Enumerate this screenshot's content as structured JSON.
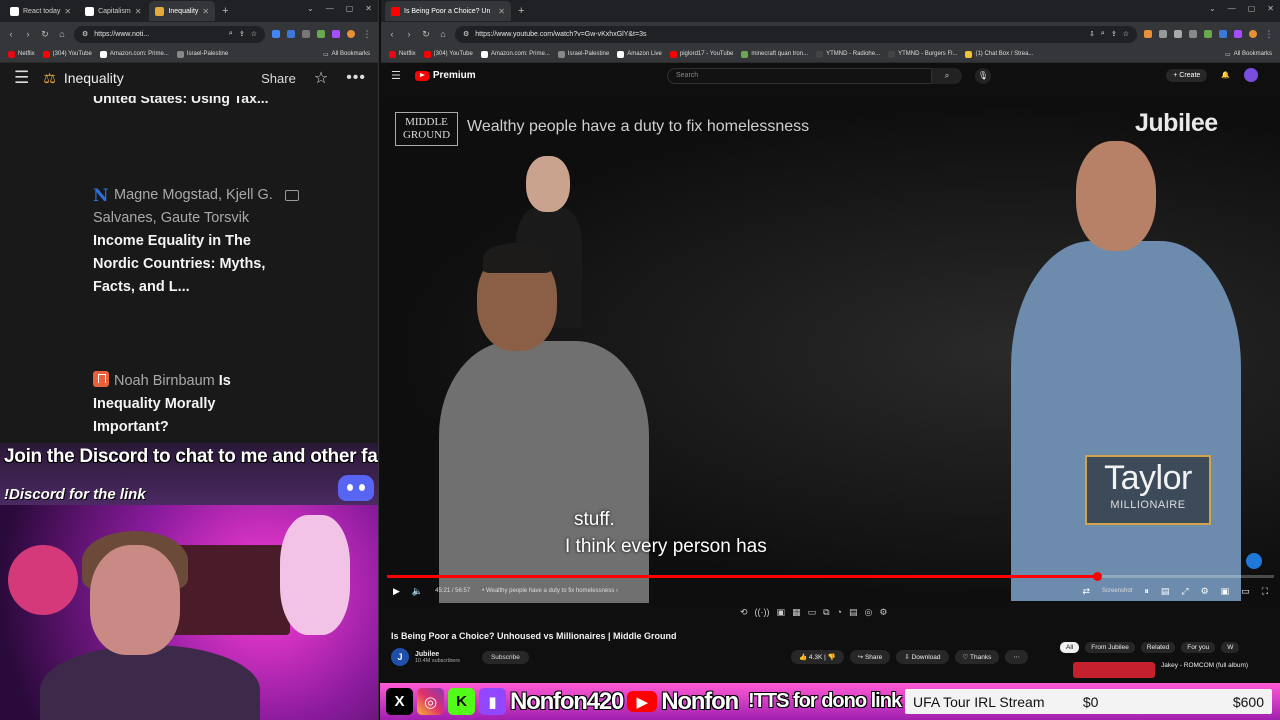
{
  "left_window": {
    "tabs": [
      {
        "label": "React today",
        "color": "#3a3a3a"
      },
      {
        "label": "Capitalism",
        "color": "#3a3a3a"
      },
      {
        "label": "Inequality",
        "color": "#3a3a3a",
        "active": true
      }
    ],
    "url": "https://www.noti...",
    "bookmarks": [
      {
        "label": "Netflix",
        "color": "#e50914"
      },
      {
        "label": "(304) YouTube",
        "color": "#ff0000"
      },
      {
        "label": "Amazon.com: Prime...",
        "color": "#ffffff"
      },
      {
        "label": "Israel-Palestine",
        "color": "#888888"
      }
    ],
    "all_bookmarks": "All Bookmarks",
    "notion": {
      "page_title": "Inequality",
      "share": "Share",
      "cut_title": "United States: Using Tax...",
      "entries": [
        {
          "authors": "Magne Mogstad, Kjell G. Salvanes, Gaute Torsvik",
          "title": "Income Equality in The Nordic Countries: Myths, Facts, and L..."
        },
        {
          "authors": "Noah Birnbaum",
          "title": "Is Inequality Morally Important?"
        }
      ]
    }
  },
  "overlay": {
    "discord_line1": "Join the Discord to chat to me and other fans!",
    "discord_line2": "!Discord for the link"
  },
  "right_window": {
    "tab_title": "Is Being Poor a Choice? Un",
    "url": "https://www.youtube.com/watch?v=Gw-vKxhxGlY&t=3s",
    "bookmarks": [
      {
        "label": "Netflix",
        "color": "#e50914"
      },
      {
        "label": "(304) YouTube",
        "color": "#ff0000"
      },
      {
        "label": "Amazon.com: Prime...",
        "color": "#ffffff"
      },
      {
        "label": "Israel-Palestine",
        "color": "#888888"
      },
      {
        "label": "Amazon Live",
        "color": "#ffffff"
      },
      {
        "label": "piglord17 - YouTube",
        "color": "#ff0000"
      },
      {
        "label": "minecraft quan tron...",
        "color": "#6aa84f"
      },
      {
        "label": "YTMND - Radiohe...",
        "color": "#444444"
      },
      {
        "label": "YTMND - Burgers Fl...",
        "color": "#444444"
      },
      {
        "label": "(1) Chat Box / Strea...",
        "color": "#f1c232"
      }
    ],
    "all_bookmarks": "All Bookmarks",
    "youtube": {
      "logo": "Premium",
      "search_placeholder": "Search",
      "create": "Create",
      "video": {
        "mg_logo": "MIDDLE GROUND",
        "headline": "Wealthy people have a duty to fix homelessness",
        "watermark": "Jubilee",
        "name": "Taylor",
        "role": "MILLIONAIRE",
        "caption_line1": "stuff.",
        "caption_line2": "I think every person has",
        "time": "45:21 / 56:57",
        "chapter": "• Wealthy people have a duty to fix homelessness  ›",
        "progress": 0.8,
        "screenshot_label": "Screenshot"
      },
      "title": "Is Being Poor a Choice? Unhoused vs Millionaires | Middle Ground",
      "channel": "Jubilee",
      "subscribers": "10.4M subscribers",
      "subscribe": "Subscribe",
      "likes": "4.3K",
      "share": "Share",
      "download": "Download",
      "thanks": "Thanks",
      "chips": [
        "All",
        "From Jubilee",
        "Related",
        "For you",
        "W"
      ],
      "next_title": "Jakey - ROMCOM (full album)"
    }
  },
  "socialbar": {
    "handle1": "Nonfon420",
    "handle2": "Nonfon",
    "tts": "!TTS for dono link",
    "goal_title": "UFA Tour IRL Stream",
    "goal_current": "$0",
    "goal_target": "$600"
  }
}
